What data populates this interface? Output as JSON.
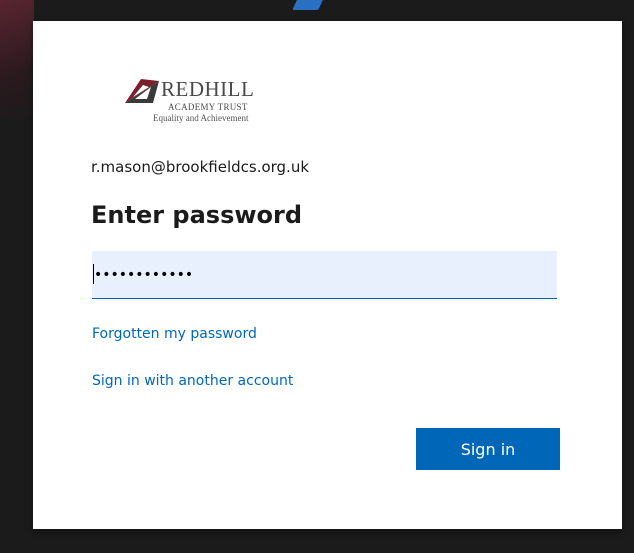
{
  "logo": {
    "name": "REDHILL",
    "subtitle": "ACADEMY TRUST",
    "tagline": "Equality and Achievement",
    "mark_color": "#7a1f2b"
  },
  "account": {
    "email": "r.mason@brookfieldcs.org.uk"
  },
  "form": {
    "title": "Enter password",
    "password_masked": "••••••••••••"
  },
  "links": {
    "forgot": "Forgotten my password",
    "other_account": "Sign in with another account"
  },
  "buttons": {
    "sign_in": "Sign in"
  },
  "colors": {
    "accent": "#0067b8",
    "input_bg": "#e8f0fe",
    "backdrop": "#1b1b1b"
  }
}
